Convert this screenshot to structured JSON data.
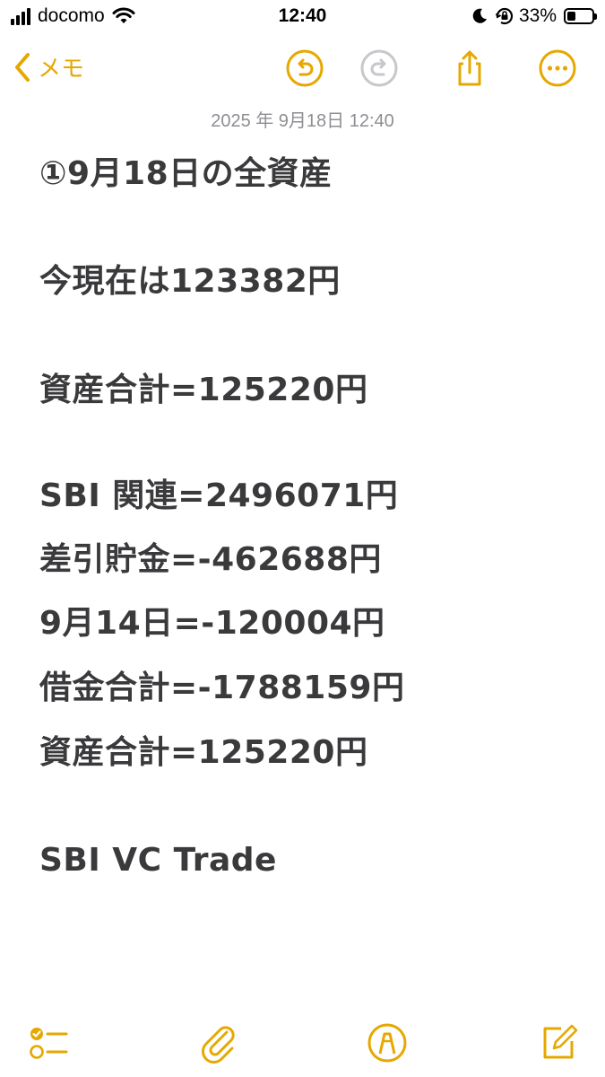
{
  "status_bar": {
    "carrier": "docomo",
    "time": "12:40",
    "battery_percent": "33%",
    "battery_level": 0.33
  },
  "nav": {
    "back_label": "メモ",
    "icons": [
      "undo-icon",
      "redo-icon",
      "share-icon",
      "more-icon"
    ]
  },
  "note": {
    "timestamp": "2025 年 9月18日 12:40",
    "lines": [
      "①9月18日の全資産",
      "今現在は123382円",
      "資産合計=125220円",
      "SBI 関連=2496071円",
      "差引貯金=-462688円",
      "9月14日=-120004円",
      "借金合計=-1788159円",
      "資産合計=125220円",
      "SBI VC Trade"
    ]
  },
  "toolbar": {
    "icons": [
      "checklist-icon",
      "paperclip-icon",
      "markup-icon",
      "compose-icon"
    ]
  },
  "colors": {
    "accent": "#e6a800",
    "text": "#3a3a3c",
    "muted": "#8e8e93"
  }
}
